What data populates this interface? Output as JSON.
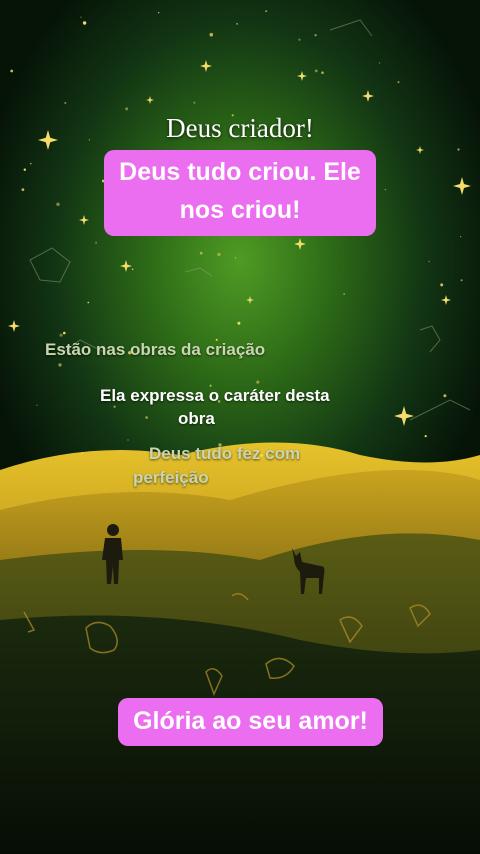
{
  "title": "Deus criador!",
  "highlight_top": "Deus tudo criou. Ele nos criou!",
  "caption_1": "Estão nas obras da criação",
  "caption_2_line1": "Ela expressa o caráter desta",
  "caption_2_line2": "obra",
  "caption_3_line1": "Deus tudo fez com",
  "caption_3_line2": "perfeição",
  "highlight_bottom": "Glória ao seu amor!",
  "colors": {
    "highlight_bg": "#ec6ef0",
    "sky_glow": "#3c8a1e",
    "hills": "#d2a81a",
    "stars": "#f5dc6a"
  }
}
